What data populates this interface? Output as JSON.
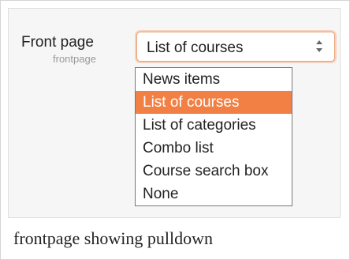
{
  "form": {
    "label": "Front page",
    "sublabel": "frontpage",
    "select_value": "List of courses",
    "options": [
      {
        "label": "News items",
        "selected": false
      },
      {
        "label": "List of courses",
        "selected": true
      },
      {
        "label": "List of categories",
        "selected": false
      },
      {
        "label": "Combo list",
        "selected": false
      },
      {
        "label": "Course search box",
        "selected": false
      },
      {
        "label": "None",
        "selected": false
      }
    ]
  },
  "caption": "frontpage showing pulldown"
}
